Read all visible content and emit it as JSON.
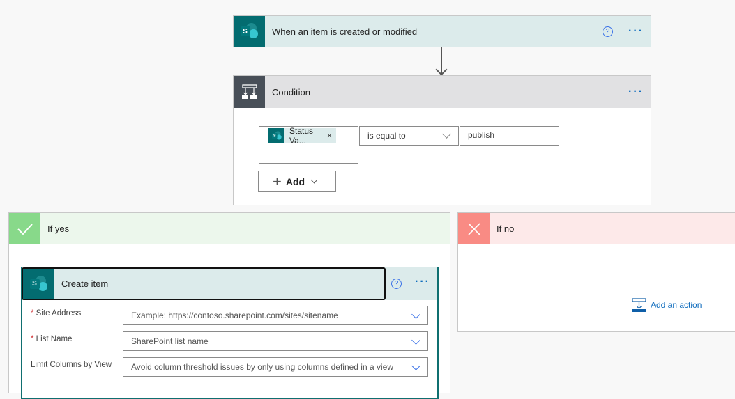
{
  "trigger": {
    "title": "When an item is created or modified",
    "icon": "sharepoint-icon"
  },
  "condition": {
    "title": "Condition",
    "token": "Status Va...",
    "operator": "is equal to",
    "value": "publish",
    "add_label": "Add"
  },
  "if_yes": {
    "title": "If yes",
    "color": "#88d98a"
  },
  "if_no": {
    "title": "If no",
    "color": "#f98b84",
    "add_action": "Add an action"
  },
  "create_item": {
    "title": "Create item",
    "fields": [
      {
        "label": "Site Address",
        "required": true,
        "placeholder": "Example: https://contoso.sharepoint.com/sites/sitename"
      },
      {
        "label": "List Name",
        "required": true,
        "placeholder": "SharePoint list name"
      },
      {
        "label": "Limit Columns by View",
        "required": false,
        "placeholder": "Avoid column threshold issues by only using columns defined in a view"
      }
    ]
  },
  "colors": {
    "accent": "#0f6cbd",
    "sharepoint": "#036c70"
  }
}
